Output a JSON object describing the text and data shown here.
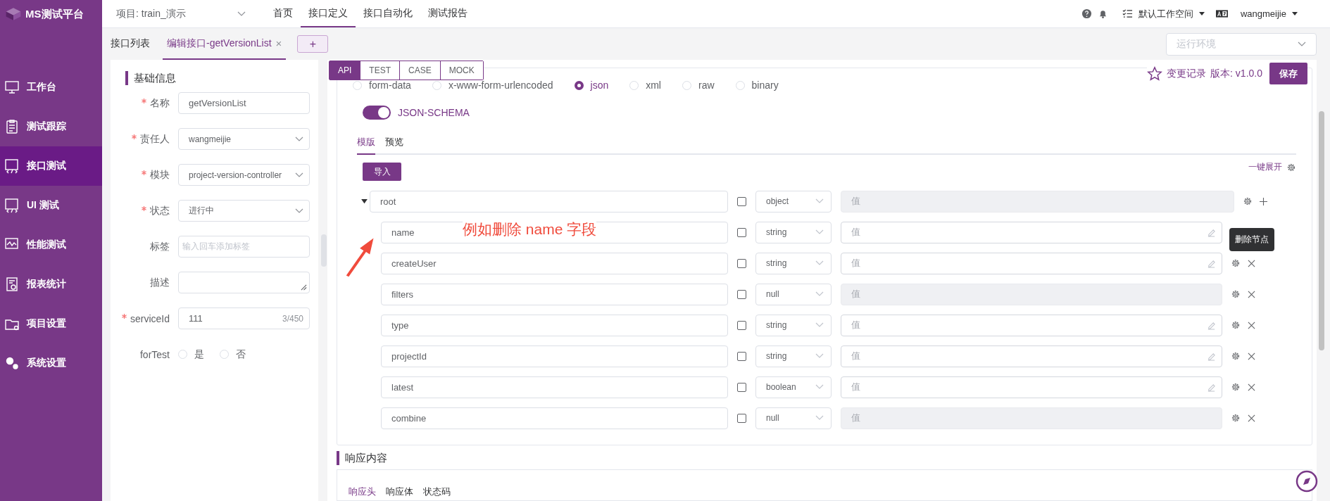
{
  "sidebar": {
    "logo": "MS测试平台",
    "items": [
      {
        "label": "工作台",
        "selected": false
      },
      {
        "label": "测试跟踪",
        "selected": false
      },
      {
        "label": "接口测试",
        "selected": true
      },
      {
        "label": "UI 测试",
        "selected": false
      },
      {
        "label": "性能测试",
        "selected": false
      },
      {
        "label": "报表统计",
        "selected": false
      },
      {
        "label": "项目设置",
        "selected": false
      },
      {
        "label": "系统设置",
        "selected": false
      }
    ]
  },
  "header": {
    "project": "项目: train_演示",
    "nav": [
      {
        "label": "首页",
        "selected": false
      },
      {
        "label": "接口定义",
        "selected": true
      },
      {
        "label": "接口自动化",
        "selected": false
      },
      {
        "label": "测试报告",
        "selected": false
      }
    ],
    "workspace": "默认工作空间",
    "user": "wangmeijie"
  },
  "tabs": {
    "items": [
      {
        "label": "接口列表",
        "selected": false,
        "closable": false
      },
      {
        "label": "编辑接口-getVersionList",
        "selected": true,
        "closable": true
      }
    ],
    "close": "×",
    "add": "+"
  },
  "environment": {
    "placeholder": "运行环境"
  },
  "basic_info": {
    "title": "基础信息",
    "fields": [
      {
        "label": "名称",
        "required": true,
        "kind": "input",
        "value": "getVersionList"
      },
      {
        "label": "责任人",
        "required": true,
        "kind": "select",
        "value": "wangmeijie"
      },
      {
        "label": "模块",
        "required": true,
        "kind": "select",
        "value": "project-version-controller"
      },
      {
        "label": "状态",
        "required": true,
        "kind": "select",
        "value": "进行中"
      },
      {
        "label": "标签",
        "required": false,
        "kind": "input",
        "placeholder": "输入回车添加标签"
      },
      {
        "label": "描述",
        "required": false,
        "kind": "textarea"
      },
      {
        "label": "serviceId",
        "required": true,
        "kind": "input",
        "value": "111",
        "counter": "3/450"
      },
      {
        "label": "forTest",
        "required": false,
        "kind": "radio",
        "options": [
          {
            "label": "是",
            "selected": false
          },
          {
            "label": "否",
            "selected": false
          }
        ]
      }
    ]
  },
  "modes": [
    {
      "label": "API",
      "selected": true
    },
    {
      "label": "TEST",
      "selected": false
    },
    {
      "label": "CASE",
      "selected": false
    },
    {
      "label": "MOCK",
      "selected": false
    }
  ],
  "version": {
    "history": "变更记录",
    "version": "版本: v1.0.0",
    "save": "保存"
  },
  "body_types": [
    {
      "label": "form-data",
      "selected": false
    },
    {
      "label": "x-www-form-urlencoded",
      "selected": false
    },
    {
      "label": "json",
      "selected": true
    },
    {
      "label": "xml",
      "selected": false
    },
    {
      "label": "raw",
      "selected": false
    },
    {
      "label": "binary",
      "selected": false
    }
  ],
  "json_schema": {
    "label": "JSON-SCHEMA",
    "on": true
  },
  "editor_tabs": [
    {
      "label": "模版",
      "selected": true
    },
    {
      "label": "预览",
      "selected": false
    }
  ],
  "import_button": "导入",
  "expand_all": "一键展开",
  "schema": {
    "name": "root",
    "required": false,
    "type": "object",
    "placeholder": "值",
    "editable": false,
    "expanded": true,
    "children": [
      {
        "name": "name",
        "required": false,
        "type": "string",
        "placeholder": "值",
        "editable": true,
        "tooltip": "删除节点"
      },
      {
        "name": "createUser",
        "required": false,
        "type": "string",
        "placeholder": "值",
        "editable": true
      },
      {
        "name": "filters",
        "required": false,
        "type": "null",
        "placeholder": "值",
        "editable": false
      },
      {
        "name": "type",
        "required": false,
        "type": "string",
        "placeholder": "值",
        "editable": true
      },
      {
        "name": "projectId",
        "required": false,
        "type": "string",
        "placeholder": "值",
        "editable": true
      },
      {
        "name": "latest",
        "required": false,
        "type": "boolean",
        "placeholder": "值",
        "editable": true
      },
      {
        "name": "combine",
        "required": false,
        "type": "null",
        "placeholder": "值",
        "editable": false
      }
    ]
  },
  "annotation": "例如删除 name 字段",
  "response": {
    "title": "响应内容",
    "tabs": [
      {
        "label": "响应头",
        "selected": true
      },
      {
        "label": "响应体",
        "selected": false
      },
      {
        "label": "状态码",
        "selected": false
      }
    ]
  }
}
